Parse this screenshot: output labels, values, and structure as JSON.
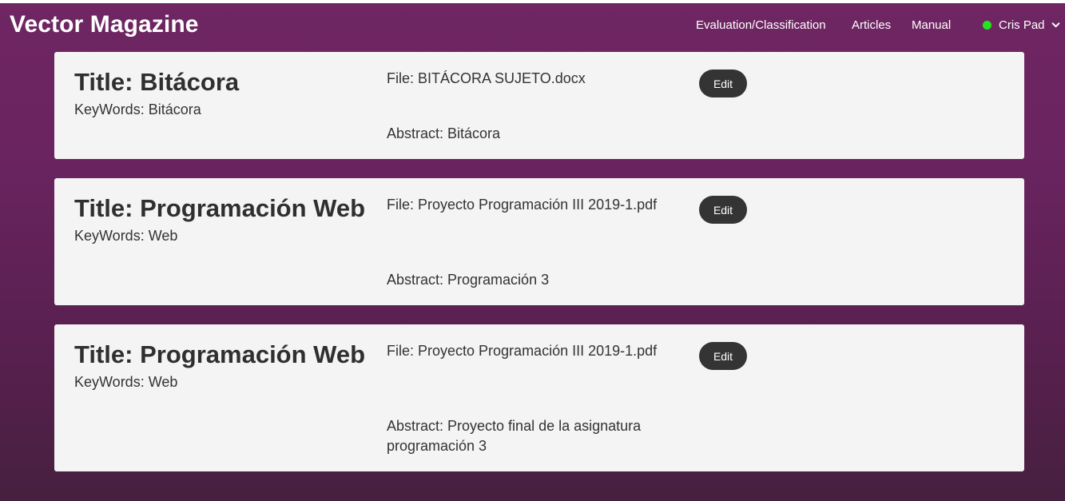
{
  "navbar": {
    "brand": "Vector Magazine",
    "links": [
      "Evaluation/Classification",
      "Articles",
      "Manual"
    ],
    "user": {
      "name": "Cris Pad",
      "status_color": "#22e51f",
      "dropdown_icon": "chevron-down-icon"
    }
  },
  "colors": {
    "background_top": "#6f2663",
    "background_bottom": "#46203f",
    "card": "#f5f4f5",
    "button": "#343434"
  },
  "articles": [
    {
      "title": "Title: Bitácora",
      "keywords": "KeyWords: Bitácora",
      "file": "File: BITÁCORA SUJETO.docx",
      "abstract": "Abstract: Bitácora",
      "edit_label": "Edit"
    },
    {
      "title": "Title: Programación Web",
      "keywords": "KeyWords: Web",
      "file": "File: Proyecto Programación III 2019-1.pdf",
      "abstract": "Abstract: Programación 3",
      "edit_label": "Edit"
    },
    {
      "title": "Title: Programación Web",
      "keywords": "KeyWords: Web",
      "file": "File: Proyecto Programación III 2019-1.pdf",
      "abstract": "Abstract: Proyecto final de la asignatura programación 3",
      "edit_label": "Edit"
    }
  ]
}
